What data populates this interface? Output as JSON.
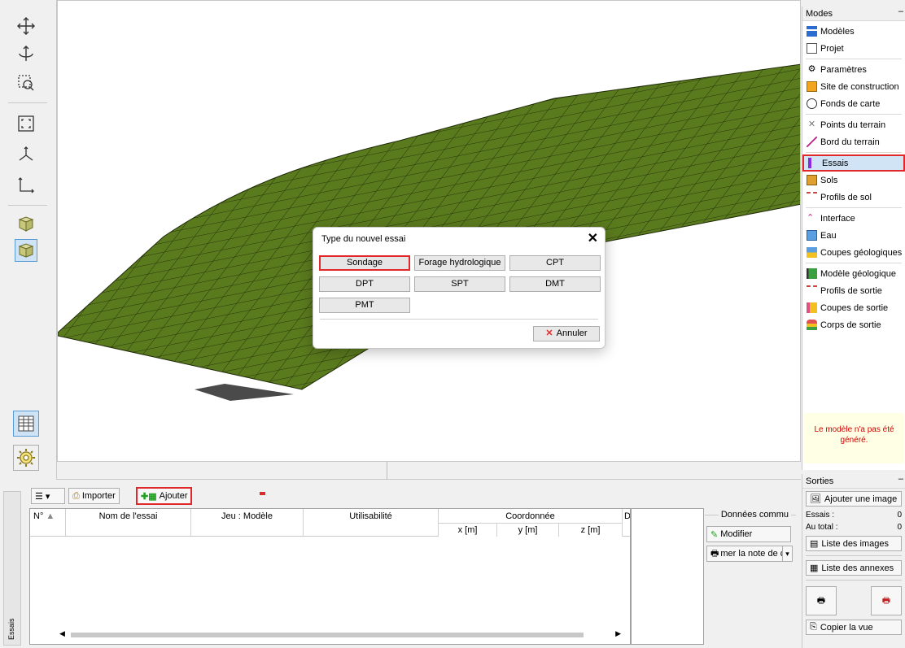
{
  "dialog": {
    "title": "Type du nouvel essai",
    "buttons": [
      "Sondage",
      "Forage hydrologique",
      "CPT",
      "DPT",
      "SPT",
      "DMT",
      "PMT"
    ],
    "cancel_label": "Annuler"
  },
  "modes": {
    "title": "Modes",
    "items": [
      {
        "label": "Modèles"
      },
      {
        "label": "Projet"
      },
      {
        "label": "Paramètres"
      },
      {
        "label": "Site de construction"
      },
      {
        "label": "Fonds de carte"
      },
      {
        "label": "Points du terrain"
      },
      {
        "label": "Bord du terrain"
      },
      {
        "label": "Essais"
      },
      {
        "label": "Sols"
      },
      {
        "label": "Profils de sol"
      },
      {
        "label": "Interface"
      },
      {
        "label": "Eau"
      },
      {
        "label": "Coupes géologiques"
      },
      {
        "label": "Modèle géologique"
      },
      {
        "label": "Profils de sortie"
      },
      {
        "label": "Coupes de sortie"
      },
      {
        "label": "Corps de sortie"
      }
    ],
    "warning": "Le modèle n'a pas été généré."
  },
  "outputs": {
    "title": "Sorties",
    "add_image": "Ajouter une image",
    "essais_label": "Essais :",
    "essais_value": "0",
    "total_label": "Au total :",
    "total_value": "0",
    "image_list": "Liste des images",
    "annex_list": "Liste des annexes",
    "copy_view": "Copier la vue"
  },
  "toolbar": {
    "import_label": "Importer",
    "add_label": "Ajouter"
  },
  "table": {
    "col_no": "N°",
    "col_name": "Nom de l'essai",
    "col_set": "Jeu : Modèle",
    "col_usability": "Utilisabilité",
    "col_coord": "Coordonnée",
    "col_x": "x [m]",
    "col_y": "y [m]",
    "col_z": "z [m]",
    "col_d": "D"
  },
  "common_data": {
    "title": "Données commu",
    "modify": "Modifier",
    "print": "mer la note de c"
  },
  "side_tab": "Essais",
  "colors": {
    "accent_red": "#e0282b",
    "mesh_green": "#5a7a1e",
    "selection_blue": "#d0e4f5"
  }
}
